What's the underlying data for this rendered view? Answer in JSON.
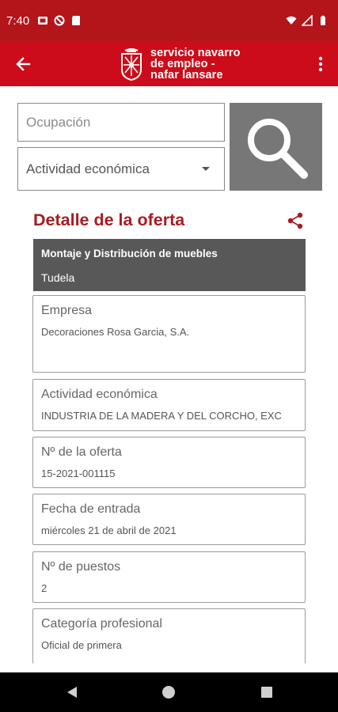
{
  "status_bar": {
    "time": "7:40"
  },
  "app_bar": {
    "logo_line1": "servicio navarro",
    "logo_line2": "de empleo -",
    "logo_line3": "nafar lansare"
  },
  "search": {
    "ocupacion_placeholder": "Ocupación",
    "actividad_selected": "Actividad económica"
  },
  "detail": {
    "title": "Detalle de la oferta",
    "offer_title": "Montaje y Distribución de muebles",
    "offer_location": "Tudela",
    "fields": {
      "empresa": {
        "label": "Empresa",
        "value": "Decoraciones Rosa Garcia, S.A."
      },
      "actividad": {
        "label": "Actividad económica",
        "value": "INDUSTRIA DE LA MADERA Y DEL CORCHO, EXC"
      },
      "num_oferta": {
        "label": "Nº de la oferta",
        "value": "15-2021-001115"
      },
      "fecha": {
        "label": "Fecha de entrada",
        "value": "miércoles 21 de abril de 2021"
      },
      "puestos": {
        "label": "Nº de puestos",
        "value": "2"
      },
      "categoria": {
        "label": "Categoría profesional",
        "value": "Oficial de primera"
      }
    }
  },
  "colors": {
    "brand_red": "#cc0c1a",
    "status_red": "#b3151b",
    "title_red": "#a81c22",
    "banner_gray": "#585858",
    "search_button_gray": "#777777"
  }
}
